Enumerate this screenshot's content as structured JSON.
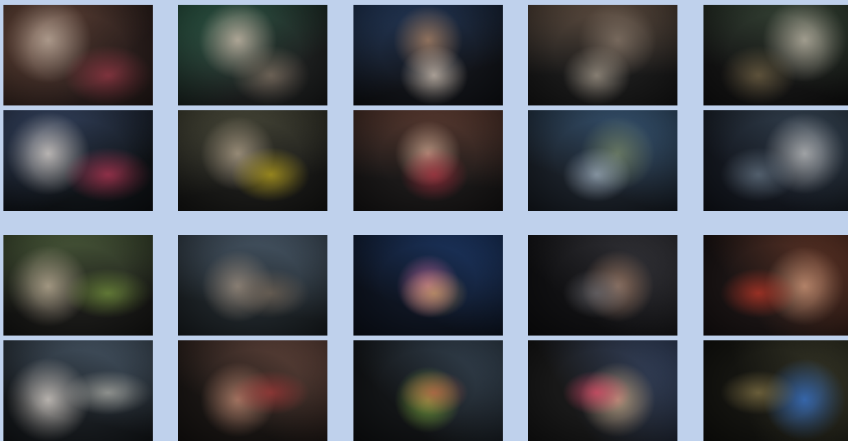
{
  "gallery": {
    "rows": [
      {
        "photos": [
          {
            "name": "mourning-women-photo",
            "palette": [
              "#6b4a3c",
              "#c9b8a8",
              "#2a1e1c",
              "#a03b4a"
            ]
          },
          {
            "name": "medics-treating-patient-photo",
            "palette": [
              "#2f5e4a",
              "#d9c7b5",
              "#1e2020",
              "#8a7a6a"
            ]
          },
          {
            "name": "children-in-shelter-photo",
            "palette": [
              "#243a5c",
              "#b58a6a",
              "#121419",
              "#e8d8c8"
            ]
          },
          {
            "name": "ruined-city-through-car-photo",
            "palette": [
              "#5a4a3e",
              "#8a7a6c",
              "#1a1a1a",
              "#b4a898"
            ]
          },
          {
            "name": "soldiers-with-machine-gun-photo",
            "palette": [
              "#3a4a3a",
              "#c8c0b0",
              "#141414",
              "#7a6a4a"
            ]
          }
        ]
      },
      {
        "photos": [
          {
            "name": "memorial-portrait-photo",
            "palette": [
              "#3a4a6a",
              "#e8e0d8",
              "#101418",
              "#c23a5a"
            ]
          },
          {
            "name": "volunteers-carrying-body-photo",
            "palette": [
              "#4a4a3a",
              "#b8a890",
              "#1a1a18",
              "#c8b020"
            ]
          },
          {
            "name": "children-sitting-indoors-photo",
            "palette": [
              "#5a3a30",
              "#d8b098",
              "#1a1818",
              "#b03040"
            ]
          },
          {
            "name": "shattered-glass-buildings-photo",
            "palette": [
              "#3a5a7a",
              "#7a8a6a",
              "#1a2028",
              "#a8b8c8"
            ]
          },
          {
            "name": "woman-in-headscarf-street-photo",
            "palette": [
              "#3a4a5a",
              "#c8c8c8",
              "#141820",
              "#6a7a8a"
            ]
          }
        ]
      },
      {
        "photos": [
          {
            "name": "family-at-grave-photo",
            "palette": [
              "#4a5a3a",
              "#c8b8a0",
              "#1a1a18",
              "#7a9a40"
            ]
          },
          {
            "name": "damaged-domed-building-photo",
            "palette": [
              "#4a5a6a",
              "#a89888",
              "#1e2428",
              "#7a6a5a"
            ]
          },
          {
            "name": "girl-in-pink-underground-photo",
            "palette": [
              "#1e3a6a",
              "#d870a8",
              "#0e1420",
              "#c8a060"
            ]
          },
          {
            "name": "boy-behind-fence-photo",
            "palette": [
              "#3a3a40",
              "#b08870",
              "#101012",
              "#6a6a70"
            ]
          },
          {
            "name": "crowd-with-banners-photo",
            "palette": [
              "#6a3a2a",
              "#d8a080",
              "#1a1414",
              "#c83a2a"
            ]
          }
        ]
      },
      {
        "photos": [
          {
            "name": "smiling-elderly-woman-photo",
            "palette": [
              "#4a5a6a",
              "#e8e0d8",
              "#181c20",
              "#b8b8b0"
            ]
          },
          {
            "name": "people-through-glass-photo",
            "palette": [
              "#6a4a40",
              "#c89078",
              "#1a1614",
              "#a83a3a"
            ]
          },
          {
            "name": "woman-in-flowered-coat-photo",
            "palette": [
              "#3a4a5a",
              "#8ac040",
              "#121416",
              "#c8604a"
            ]
          },
          {
            "name": "children-in-crowd-photo",
            "palette": [
              "#3a4a6a",
              "#d8b890",
              "#181818",
              "#e84a6a"
            ]
          },
          {
            "name": "soldier-with-flag-photo",
            "palette": [
              "#3a3a2a",
              "#3a7ad8",
              "#141410",
              "#8a7a4a"
            ]
          }
        ]
      }
    ]
  }
}
